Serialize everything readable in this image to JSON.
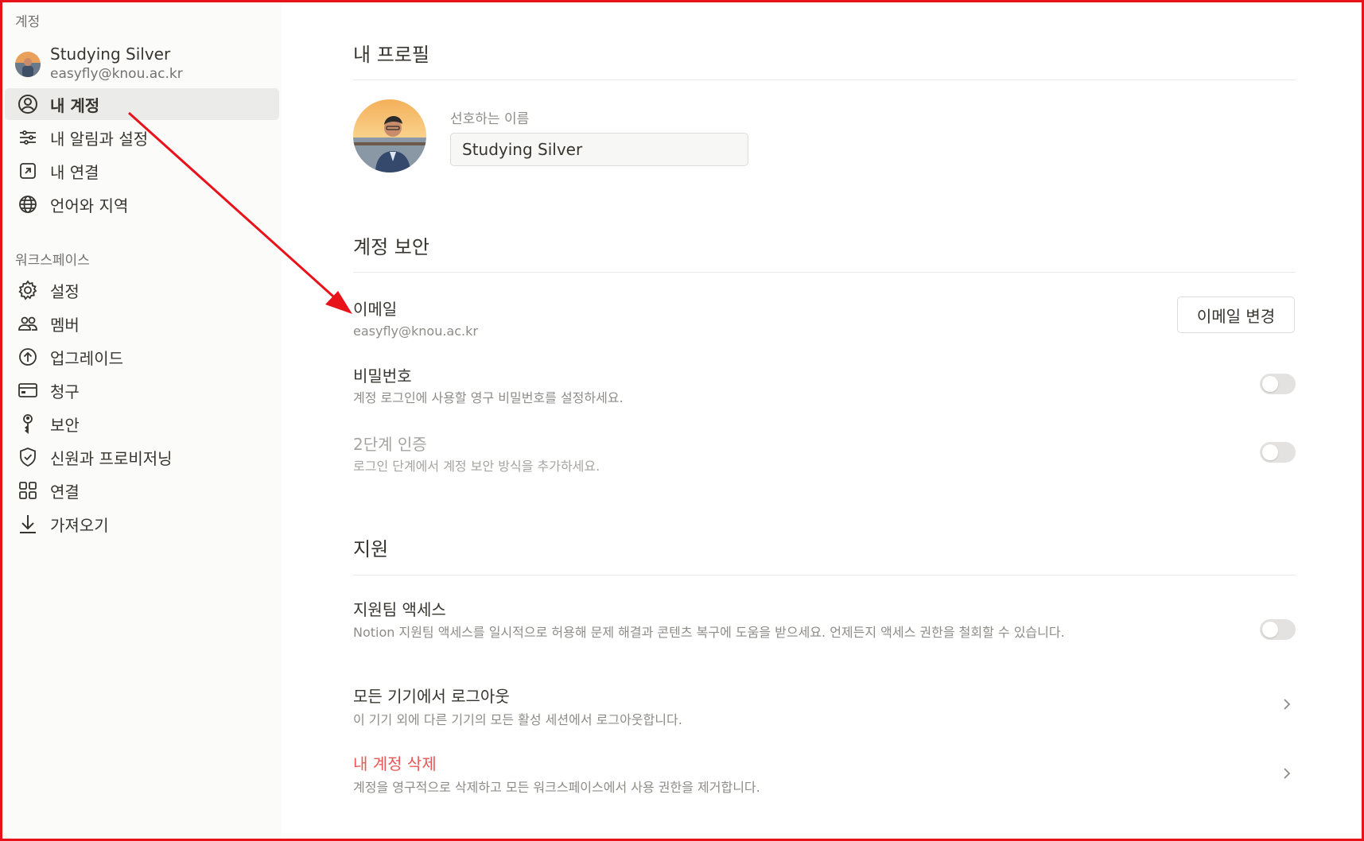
{
  "sidebar": {
    "account_section": "계정",
    "profile": {
      "name": "Studying Silver",
      "email": "easyfly@knou.ac.kr"
    },
    "account_items": [
      {
        "label": "내 계정",
        "icon": "user-circle-icon"
      },
      {
        "label": "내 알림과 설정",
        "icon": "sliders-icon"
      },
      {
        "label": "내 연결",
        "icon": "arrow-up-right-box-icon"
      },
      {
        "label": "언어와 지역",
        "icon": "globe-icon"
      }
    ],
    "workspace_section": "워크스페이스",
    "workspace_items": [
      {
        "label": "설정",
        "icon": "gear-icon"
      },
      {
        "label": "멤버",
        "icon": "people-icon"
      },
      {
        "label": "업그레이드",
        "icon": "arrow-up-circle-icon"
      },
      {
        "label": "청구",
        "icon": "credit-card-icon"
      },
      {
        "label": "보안",
        "icon": "key-icon"
      },
      {
        "label": "신원과 프로비저닝",
        "icon": "shield-check-icon"
      },
      {
        "label": "연결",
        "icon": "grid-icon"
      },
      {
        "label": "가져오기",
        "icon": "download-icon"
      }
    ]
  },
  "main": {
    "profile_title": "내 프로필",
    "preferred_name_label": "선호하는 이름",
    "preferred_name_value": "Studying Silver",
    "security_title": "계정 보안",
    "email_label": "이메일",
    "email_value": "easyfly@knou.ac.kr",
    "change_email_button": "이메일 변경",
    "password_label": "비밀번호",
    "password_desc": "계정 로그인에 사용할 영구 비밀번호를 설정하세요.",
    "twofa_label": "2단계 인증",
    "twofa_desc": "로그인 단계에서 계정 보안 방식을 추가하세요.",
    "support_title": "지원",
    "support_access_label": "지원팀 액세스",
    "support_access_desc": "Notion 지원팀 액세스를 일시적으로 허용해 문제 해결과 콘텐츠 복구에 도움을 받으세요. 언제든지 액세스 권한을 철회할 수 있습니다.",
    "logout_all_label": "모든 기기에서 로그아웃",
    "logout_all_desc": "이 기기 외에 다른 기기의 모든 활성 세션에서 로그아웃합니다.",
    "delete_account_label": "내 계정 삭제",
    "delete_account_desc": "계정을 영구적으로 삭제하고 모든 워크스페이스에서 사용 권한을 제거합니다."
  },
  "colors": {
    "danger": "#eb5757",
    "annotation_arrow": "#e8121b",
    "sidebar_bg": "#fbfbfa",
    "active_item_bg": "#ebebea"
  }
}
